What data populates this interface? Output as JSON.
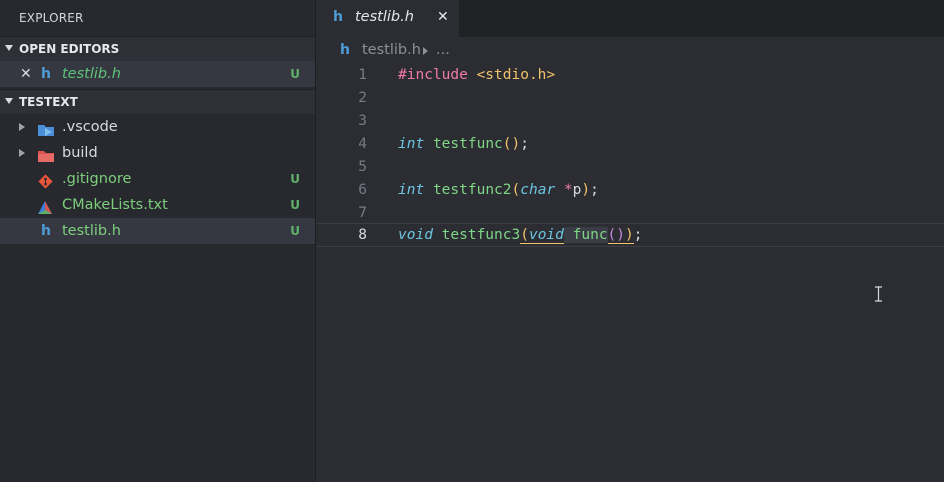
{
  "sidebar": {
    "title": "EXPLORER",
    "open_editors": {
      "header": "OPEN EDITORS",
      "items": [
        {
          "close": "✕",
          "icon": "h",
          "name": "testlib.h",
          "status": "U"
        }
      ]
    },
    "folder": {
      "header": "TESTEXT",
      "items": [
        {
          "name": ".vscode",
          "icon": "vscode-folder-icon",
          "status": ""
        },
        {
          "name": "build",
          "icon": "folder-icon",
          "status": ""
        },
        {
          "name": ".gitignore",
          "icon": "git-icon",
          "status": "U"
        },
        {
          "name": "CMakeLists.txt",
          "icon": "cmake-icon",
          "status": "U"
        },
        {
          "name": "testlib.h",
          "icon": "h",
          "status": "U"
        }
      ]
    }
  },
  "tab": {
    "icon": "h",
    "label": "testlib.h",
    "close": "✕"
  },
  "breadcrumb": {
    "icon": "h",
    "file": "testlib.h",
    "more": "..."
  },
  "editor": {
    "current_line": 8,
    "lines": [
      {
        "n": "1",
        "parts": [
          "#include",
          " ",
          "<stdio.h>"
        ]
      },
      {
        "n": "2"
      },
      {
        "n": "3"
      },
      {
        "n": "4",
        "parts": [
          "int",
          " ",
          "testfunc",
          "()",
          ";"
        ]
      },
      {
        "n": "5"
      },
      {
        "n": "6",
        "parts": [
          "int",
          " ",
          "testfunc2",
          "(",
          "char",
          " ",
          "*",
          "p",
          ")",
          ";"
        ]
      },
      {
        "n": "7"
      },
      {
        "n": "8",
        "parts": [
          "void",
          " ",
          "testfunc3",
          "(",
          "void",
          " ",
          "func",
          "()",
          ")",
          ";"
        ]
      }
    ]
  },
  "colors": {
    "background": "#2b2d33",
    "sidebar": "#27292e",
    "keyword_include": "#f07ba6",
    "string": "#f0c36a",
    "type": "#6ec4e0",
    "function": "#7fd685",
    "untracked": "#5fb06b"
  }
}
